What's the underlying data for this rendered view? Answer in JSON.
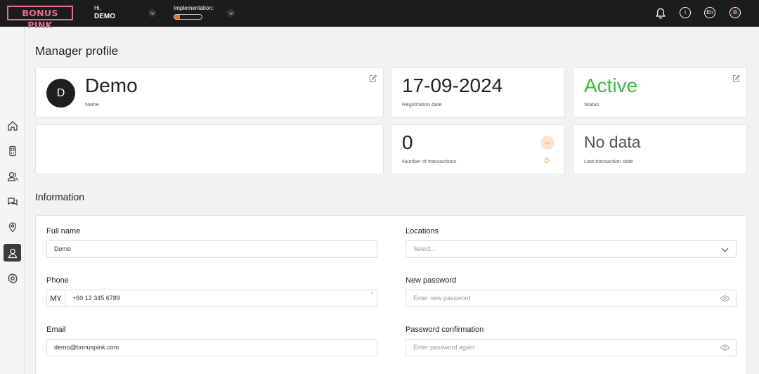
{
  "header": {
    "logo": "BONUS PINK",
    "greeting": "Hi,",
    "username": "DEMO",
    "implementation_label": "Implementation:",
    "implementation_progress_percent": 20,
    "language": "En",
    "avatar_letter": "B"
  },
  "sidebar": {
    "items": [
      {
        "name": "home",
        "icon": "home-icon",
        "active": false
      },
      {
        "name": "terminal",
        "icon": "terminal-icon",
        "active": false
      },
      {
        "name": "customers",
        "icon": "customers-icon",
        "active": false
      },
      {
        "name": "messages",
        "icon": "chat-icon",
        "active": false
      },
      {
        "name": "locations",
        "icon": "map-pin-icon",
        "active": false
      },
      {
        "name": "profile",
        "icon": "user-icon",
        "active": true
      },
      {
        "name": "settings",
        "icon": "gear-icon",
        "active": false
      }
    ]
  },
  "page": {
    "title": "Manager profile"
  },
  "profile": {
    "avatar_letter": "D",
    "name_value": "Demo",
    "name_label": "Name",
    "registration_date": "17-09-2024",
    "registration_label": "Registration date",
    "status_value": "Active",
    "status_label": "Status",
    "status_color": "#3dba3d",
    "transactions_value": "0",
    "transactions_label": "Number of transactions",
    "transactions_secondary": "0",
    "last_tx_value": "No data",
    "last_tx_label": "Last transaction date"
  },
  "information": {
    "title": "Information",
    "full_name_label": "Full name",
    "full_name_value": "Demo",
    "locations_label": "Locations",
    "locations_placeholder": "Select...",
    "phone_label": "Phone",
    "phone_country": "MY",
    "phone_value": "+60 12 345 6789",
    "phone_required_mark": "*",
    "new_password_label": "New password",
    "new_password_placeholder": "Enter new password",
    "email_label": "Email",
    "email_value": "demo@bonuspink.com",
    "password_confirm_label": "Password confirmation",
    "password_confirm_placeholder": "Enter password again"
  }
}
